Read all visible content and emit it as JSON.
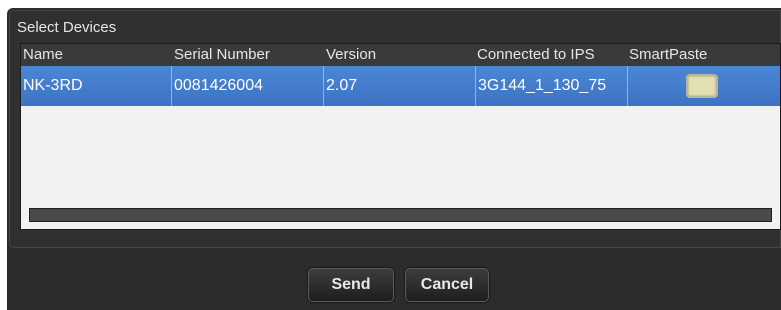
{
  "dialog": {
    "panel_title": "Select Devices"
  },
  "table": {
    "columns": [
      "Name",
      "Serial Number",
      "Version",
      "Connected to IPS",
      "SmartPaste"
    ],
    "rows": [
      {
        "name": "NK-3RD",
        "serial_number": "0081426004",
        "version": "2.07",
        "connected_to_ips": "3G144_1_130_75",
        "smartpaste_checked": false
      }
    ],
    "selected_row_color": "#3c74c4"
  },
  "buttons": {
    "send_label": "Send",
    "cancel_label": "Cancel"
  }
}
